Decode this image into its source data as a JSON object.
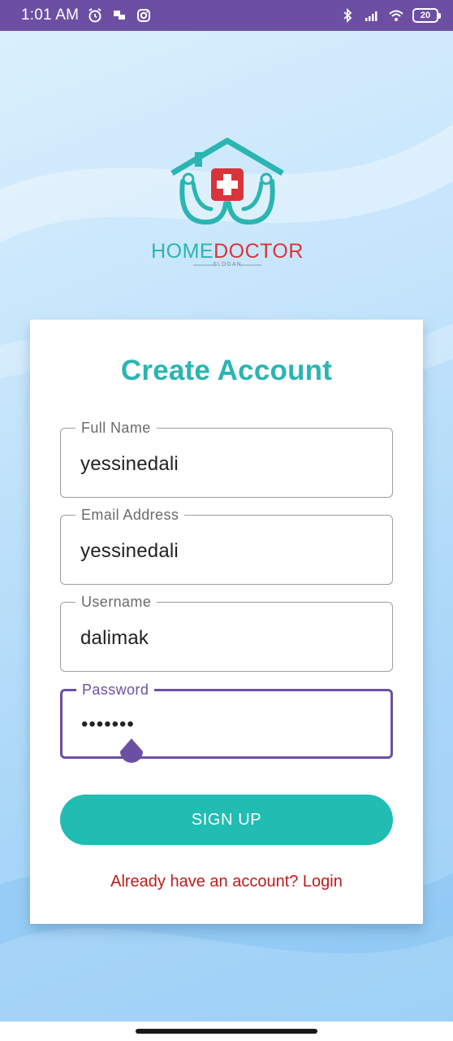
{
  "status_bar": {
    "time": "1:01 AM",
    "battery": "20"
  },
  "logo": {
    "brand_home": "HOME",
    "brand_doctor": "DOCTOR",
    "slogan": "SLOGAN"
  },
  "form": {
    "title": "Create Account",
    "fields": [
      {
        "label": "Full Name",
        "value": "yessinedali"
      },
      {
        "label": "Email Address",
        "value": "yessinedali"
      },
      {
        "label": "Username",
        "value": "dalimak"
      },
      {
        "label": "Password",
        "value": "•••••••"
      }
    ],
    "submit_label": "SIGN UP",
    "login_link": "Already have an account? Login"
  },
  "colors": {
    "accent": "#6c4fa3",
    "teal": "#21bcb2",
    "link": "#c01a1a"
  }
}
